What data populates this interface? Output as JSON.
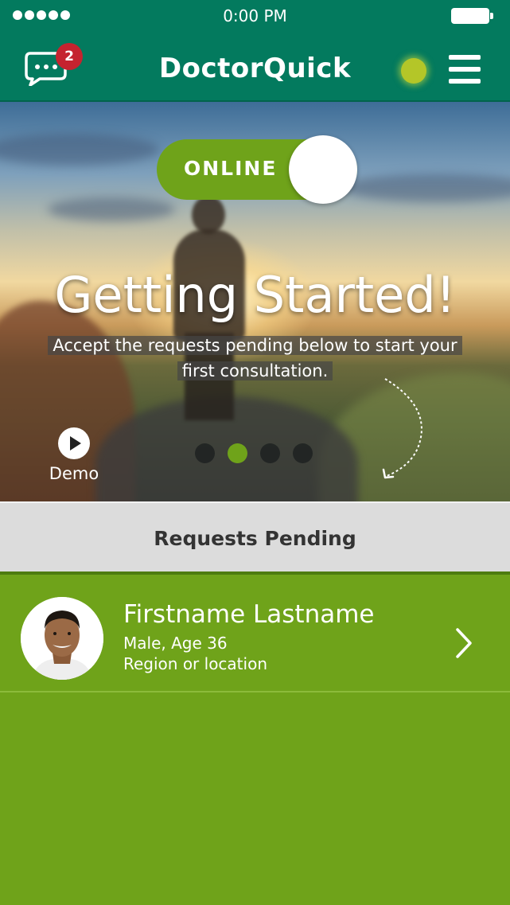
{
  "status_bar": {
    "time": "0:00 PM"
  },
  "header": {
    "app_title": "DoctorQuick",
    "message_badge_count": "2",
    "status_dot_color": "#b4c628"
  },
  "hero": {
    "toggle_label": "ONLINE",
    "title": "Getting Started!",
    "subtitle_line1": "Accept the requests pending below to start your",
    "subtitle_line2": "first consultation.",
    "demo_label": "Demo",
    "carousel_dots": 4,
    "active_dot": 2
  },
  "requests": {
    "section_title": "Requests Pending",
    "items": [
      {
        "name": "Firstname Lastname",
        "details": "Male, Age 36",
        "location": "Region or location"
      }
    ]
  },
  "colors": {
    "header_bg": "#037a5e",
    "accent_green": "#6fa31a",
    "badge_red": "#c5232f",
    "section_bg": "#dcdcdc"
  }
}
